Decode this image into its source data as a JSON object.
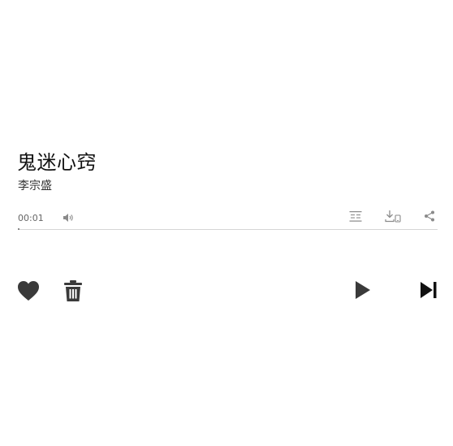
{
  "track": {
    "title": "鬼迷心窍",
    "artist": "李宗盛"
  },
  "playback": {
    "current_time": "00:01",
    "progress_fraction": 0.004
  },
  "icons": {
    "volume": "volume-icon",
    "lyrics": "lyrics-icon",
    "download": "download-to-device-icon",
    "share": "share-icon",
    "favorite": "heart-icon",
    "delete": "trash-icon",
    "play": "play-icon",
    "next": "skip-next-icon"
  },
  "colors": {
    "title": "#111111",
    "icon_light": "#8a8a8a",
    "icon_dark": "#3a3a3a",
    "progress_track": "#d6d6d6"
  }
}
